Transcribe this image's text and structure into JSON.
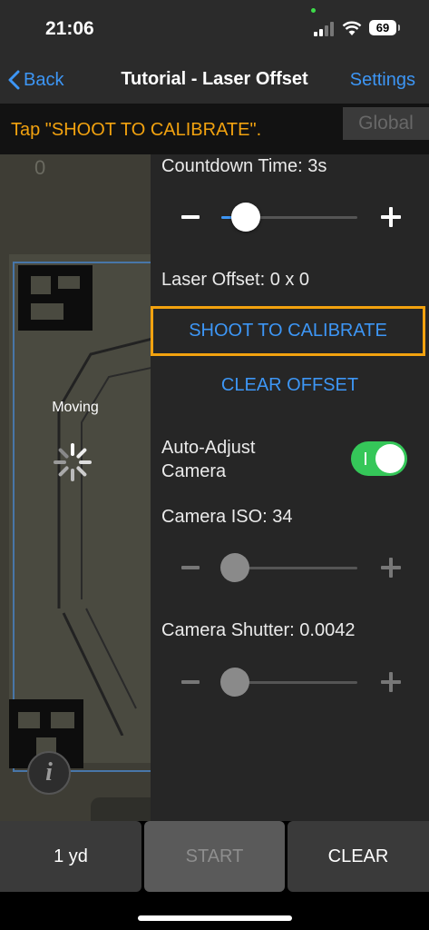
{
  "status_bar": {
    "time": "21:06",
    "battery": "69",
    "icons": [
      "cellular-signal-icon",
      "wifi-icon",
      "battery-icon"
    ]
  },
  "nav": {
    "back_label": "Back",
    "title": "Tutorial - Laser Offset",
    "settings_label": "Settings"
  },
  "instruction": {
    "text": "Tap \"SHOOT TO CALIBRATE\".",
    "global_label": "Global"
  },
  "camera": {
    "score": "0",
    "moving_label": "Moving",
    "info_label": "i"
  },
  "panel": {
    "countdown": {
      "label": "Countdown Time: 3s",
      "slider_fraction": 0.18
    },
    "laser_offset_label": "Laser Offset: 0 x 0",
    "calibrate_label": "SHOOT TO CALIBRATE",
    "clear_offset_label": "CLEAR OFFSET",
    "auto_adjust": {
      "label_line1": "Auto-Adjust",
      "label_line2": "Camera",
      "on": true
    },
    "iso": {
      "label": "Camera ISO: 34",
      "slider_fraction": 0.1
    },
    "shutter": {
      "label": "Camera Shutter: 0.0042",
      "slider_fraction": 0.1
    }
  },
  "bottom_bar": {
    "distance_label": "1 yd",
    "start_label": "START",
    "clear_label": "CLEAR"
  },
  "colors": {
    "accent_blue": "#3d96f5",
    "instruction_orange": "#f2a20f",
    "toggle_green": "#35c759"
  }
}
